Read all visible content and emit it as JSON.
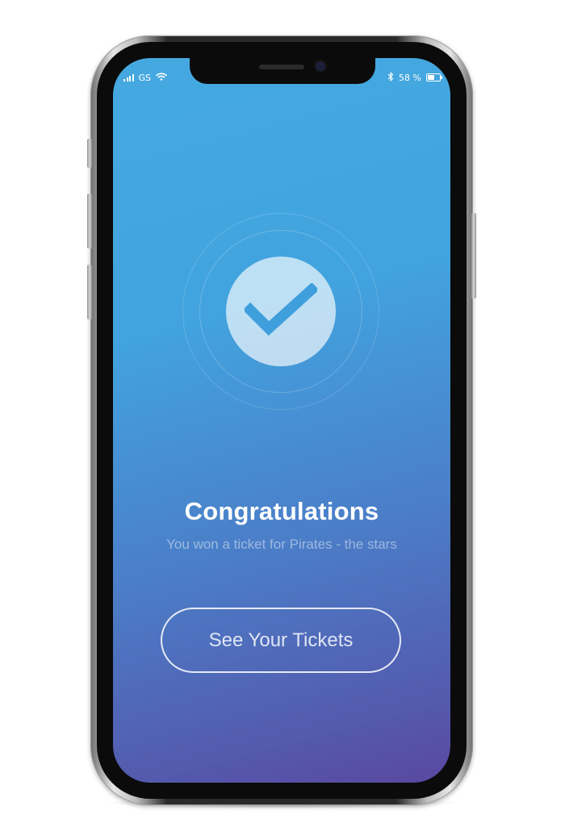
{
  "status_bar": {
    "carrier": "GS",
    "battery_text": "58 %",
    "battery_level": 0.58,
    "icons": [
      "signal-icon",
      "wifi-icon",
      "bluetooth-icon",
      "battery-icon"
    ]
  },
  "main": {
    "icon": "checkmark-icon",
    "title": "Congratulations",
    "subtitle": "You won a ticket for Pirates - the stars",
    "cta_label": "See Your Tickets"
  },
  "colors": {
    "gradient_top": "#45a9e0",
    "gradient_bottom": "#5a47a0",
    "check_color": "#3f9fdc",
    "text": "#ffffff"
  }
}
